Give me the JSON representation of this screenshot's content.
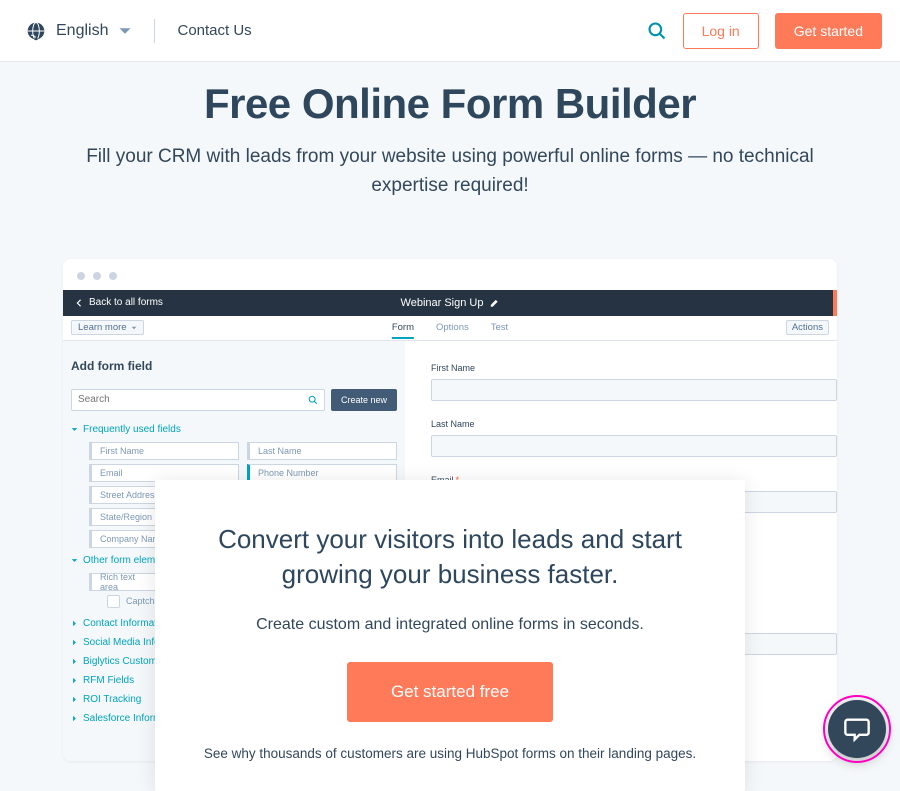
{
  "nav": {
    "language": "English",
    "contact": "Contact Us",
    "login": "Log in",
    "get_started": "Get started"
  },
  "hero": {
    "title": "Free Online Form Builder",
    "subtitle": "Fill your CRM with leads from your website using powerful online forms — no technical expertise required!"
  },
  "app": {
    "back": "Back to all forms",
    "title": "Webinar Sign Up",
    "learn_more": "Learn more",
    "tabs": {
      "form": "Form",
      "options": "Options",
      "test": "Test"
    },
    "actions": "Actions",
    "panel_title": "Add form field",
    "search_placeholder": "Search",
    "create_new": "Create new",
    "cats": {
      "freq": "Frequently used fields",
      "other": "Other form elements",
      "contact": "Contact Information",
      "social": "Social Media Information",
      "biglytics": "Biglytics Custom",
      "rfm": "RFM Fields",
      "roi": "ROI Tracking",
      "salesforce": "Salesforce Information"
    },
    "fields": {
      "first_name": "First Name",
      "last_name": "Last Name",
      "email": "Email",
      "phone": "Phone Number",
      "street": "Street Address",
      "state": "State/Region",
      "company": "Company Name",
      "rich_text": "Rich text area",
      "captcha": "Captcha (SPAM prevention)"
    },
    "preview": {
      "first_name": "First Name",
      "last_name": "Last Name",
      "email": "Email"
    }
  },
  "overlay": {
    "title": "Convert your visitors into leads and start growing your business faster.",
    "sub": "Create custom and integrated online forms in seconds.",
    "cta": "Get started free",
    "foot": "See why thousands of customers are using HubSpot forms on their landing pages."
  }
}
